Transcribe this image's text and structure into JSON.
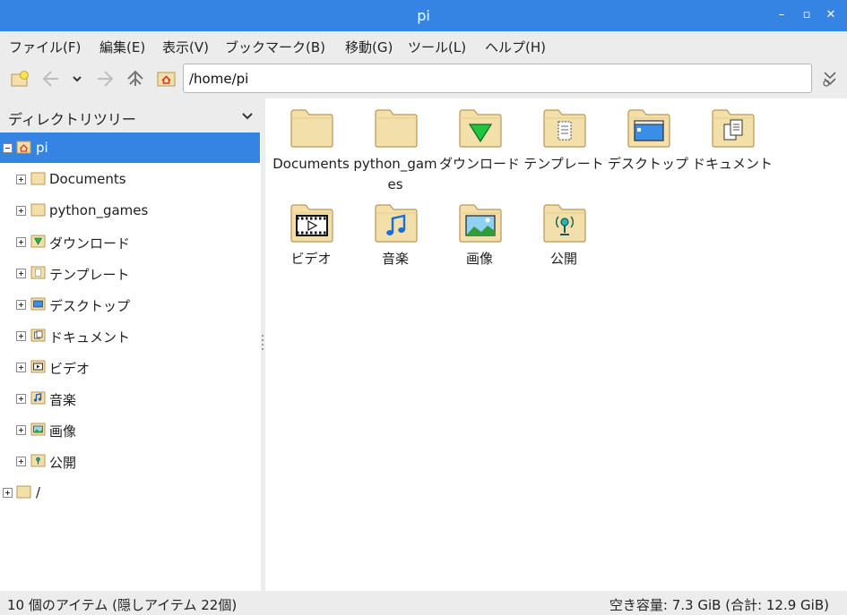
{
  "window": {
    "title": "pi"
  },
  "menu": [
    "ファイル(F)",
    "編集(E)",
    "表示(V)",
    "ブックマーク(B)",
    "移動(G)",
    "ツール(L)",
    "ヘルプ(H)"
  ],
  "address": {
    "value": "/home/pi"
  },
  "sidebar": {
    "header": "ディレクトリツリー",
    "root": "pi",
    "children": [
      "Documents",
      "python_games",
      "ダウンロード",
      "テンプレート",
      "デスクトップ",
      "ドキュメント",
      "ビデオ",
      "音楽",
      "画像",
      "公開"
    ],
    "filesystem_root": "/"
  },
  "files": [
    {
      "name": "Documents",
      "icon": "folder-icon"
    },
    {
      "name": "python_games",
      "icon": "folder-icon"
    },
    {
      "name": "ダウンロード",
      "icon": "folder-download-icon"
    },
    {
      "name": "テンプレート",
      "icon": "folder-templates-icon"
    },
    {
      "name": "デスクトップ",
      "icon": "folder-desktop-icon"
    },
    {
      "name": "ドキュメント",
      "icon": "folder-documents-icon"
    },
    {
      "name": "ビデオ",
      "icon": "folder-videos-icon"
    },
    {
      "name": "音楽",
      "icon": "folder-music-icon"
    },
    {
      "name": "画像",
      "icon": "folder-pictures-icon"
    },
    {
      "name": "公開",
      "icon": "folder-publicshare-icon"
    }
  ],
  "status": {
    "left": "10 個のアイテム (隠しアイテム 22個)",
    "right": "空き容量: 7.3 GiB (合計: 12.9 GiB)"
  },
  "colors": {
    "accent": "#3584e4",
    "folder": "#f3dfa9",
    "folder_edge": "#b8975a"
  }
}
